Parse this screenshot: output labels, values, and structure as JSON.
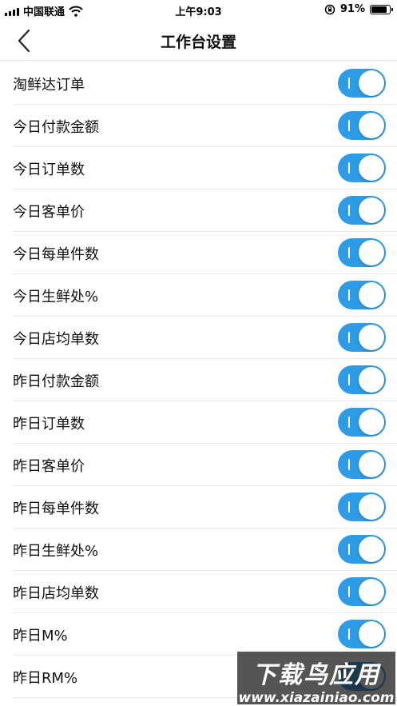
{
  "status_bar": {
    "carrier": "中国联通",
    "time": "上午9:03",
    "battery": "91%",
    "battery_level": 0.91,
    "icons": [
      "signal-icon",
      "wifi-icon",
      "rotation-lock-icon",
      "battery-icon"
    ]
  },
  "nav": {
    "title": "工作台设置",
    "back_icon": "chevron-left-icon"
  },
  "settings": [
    {
      "label": "淘鲜达订单",
      "enabled": true
    },
    {
      "label": "今日付款金额",
      "enabled": true
    },
    {
      "label": "今日订单数",
      "enabled": true
    },
    {
      "label": "今日客单价",
      "enabled": true
    },
    {
      "label": "今日每单件数",
      "enabled": true
    },
    {
      "label": "今日生鲜处%",
      "enabled": true
    },
    {
      "label": "今日店均单数",
      "enabled": true
    },
    {
      "label": "昨日付款金额",
      "enabled": true
    },
    {
      "label": "昨日订单数",
      "enabled": true
    },
    {
      "label": "昨日客单价",
      "enabled": true
    },
    {
      "label": "昨日每单件数",
      "enabled": true
    },
    {
      "label": "昨日生鲜处%",
      "enabled": true
    },
    {
      "label": "昨日店均单数",
      "enabled": true
    },
    {
      "label": "昨日M%",
      "enabled": true
    },
    {
      "label": "昨日RM%",
      "enabled": true
    }
  ],
  "watermark": {
    "main": "下载鸟应用",
    "sub": "www.xiazainiao.com"
  },
  "colors": {
    "toggle_on": "#2e9be6",
    "divider": "#e6e6e6"
  }
}
